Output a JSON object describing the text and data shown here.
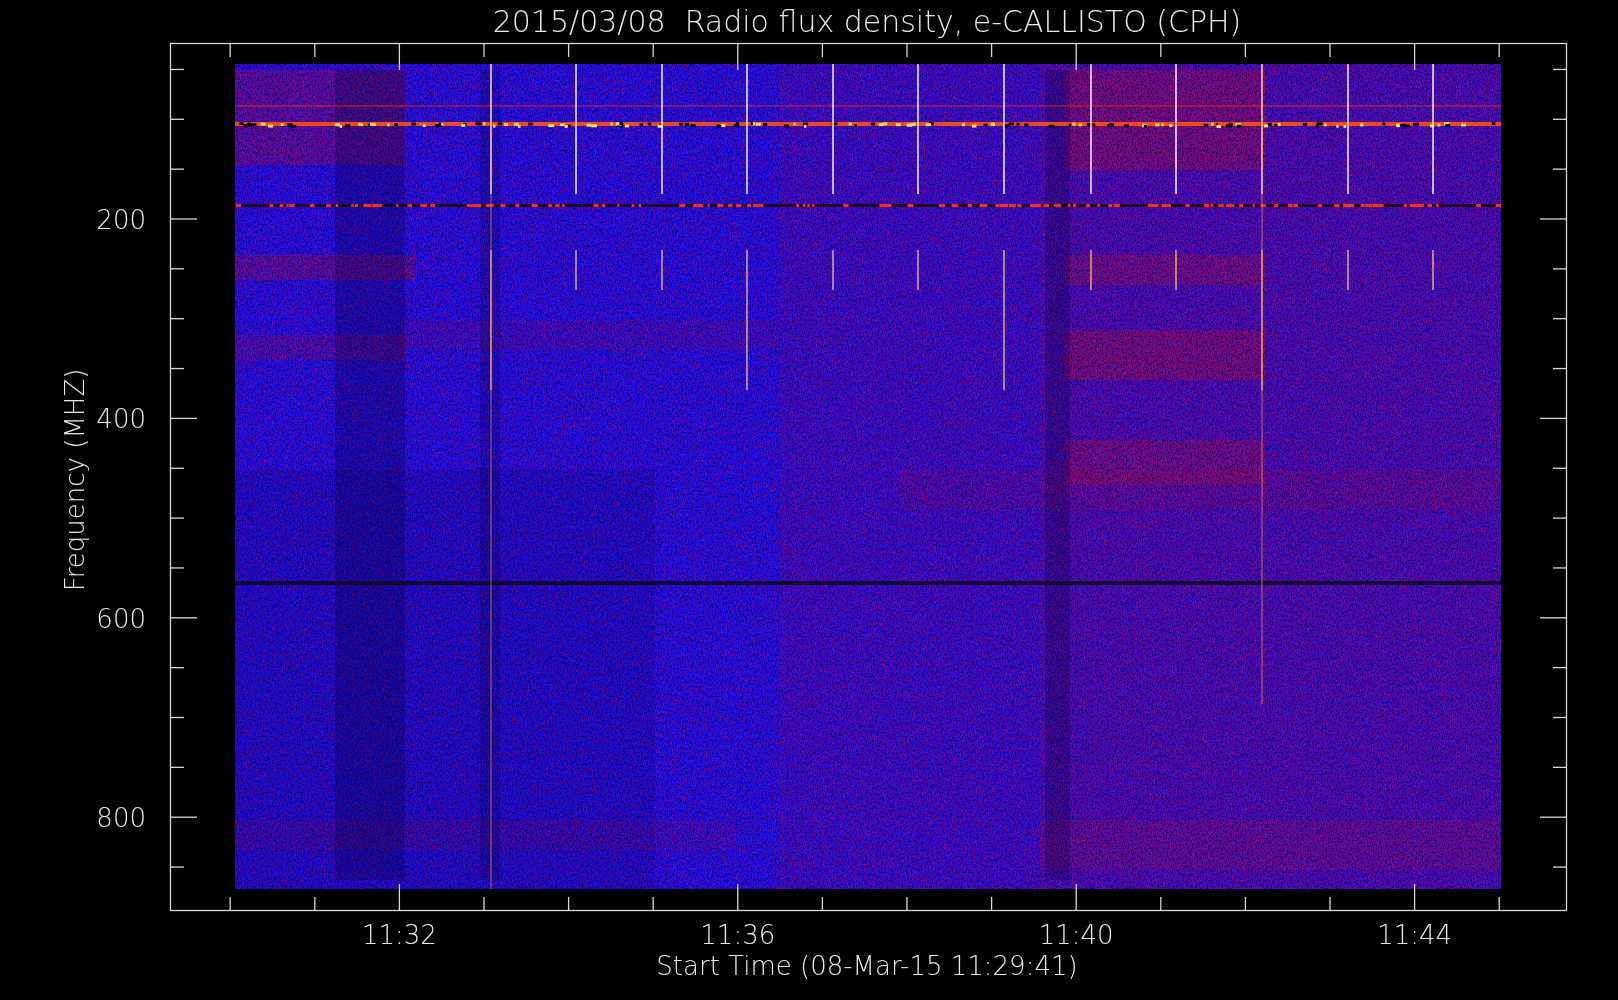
{
  "title": "2015/03/08  Radio flux density, e-CALLISTO (CPH)",
  "plot": {
    "y_label": "Frequency (MHZ)",
    "y_ticks": [
      "200",
      "400",
      "600",
      "800"
    ],
    "x_ticks": [
      "11:32",
      "11:36",
      "11:40",
      "11:44"
    ],
    "x_label": "Start Time (08-Mar-15 11:29:41)"
  }
}
